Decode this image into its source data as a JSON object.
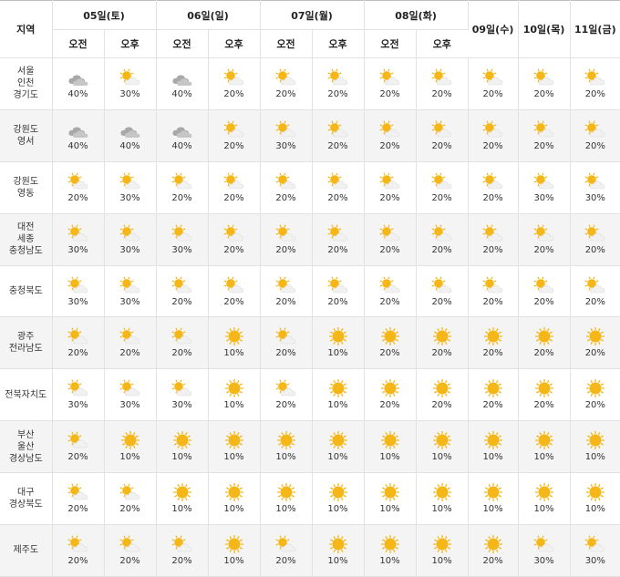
{
  "header": {
    "region_label": "지역",
    "days": [
      {
        "label": "05일(토)",
        "split": true
      },
      {
        "label": "06일(일)",
        "split": true
      },
      {
        "label": "07일(월)",
        "split": true
      },
      {
        "label": "08일(화)",
        "split": true
      },
      {
        "label": "09일(수)",
        "split": false
      },
      {
        "label": "10일(목)",
        "split": false
      },
      {
        "label": "11일(금)",
        "split": false
      }
    ],
    "am_label": "오전",
    "pm_label": "오후"
  },
  "icons": {
    "cloudy": "cloud-icon",
    "partly-cloudy": "sun-behind-cloud-icon",
    "sunny": "sun-icon"
  },
  "colors": {
    "sun": "#f5b617",
    "cloud_light": "#f1f1f1",
    "cloud_dark": "#a8a8a8",
    "row_shade": "#f4f4f4",
    "border": "#e2e2e2"
  },
  "regions": [
    {
      "name": [
        "서울",
        "인천",
        "경기도"
      ],
      "cells": [
        {
          "icon": "cloudy",
          "pct": "40%"
        },
        {
          "icon": "partly-cloudy",
          "pct": "30%"
        },
        {
          "icon": "cloudy",
          "pct": "40%"
        },
        {
          "icon": "partly-cloudy",
          "pct": "20%"
        },
        {
          "icon": "partly-cloudy",
          "pct": "20%"
        },
        {
          "icon": "partly-cloudy",
          "pct": "20%"
        },
        {
          "icon": "partly-cloudy",
          "pct": "20%"
        },
        {
          "icon": "partly-cloudy",
          "pct": "20%"
        },
        {
          "icon": "partly-cloudy",
          "pct": "20%"
        },
        {
          "icon": "partly-cloudy",
          "pct": "20%"
        },
        {
          "icon": "partly-cloudy",
          "pct": "20%"
        }
      ]
    },
    {
      "name": [
        "강원도",
        "영서"
      ],
      "cells": [
        {
          "icon": "cloudy",
          "pct": "40%"
        },
        {
          "icon": "cloudy",
          "pct": "40%"
        },
        {
          "icon": "cloudy",
          "pct": "40%"
        },
        {
          "icon": "partly-cloudy",
          "pct": "20%"
        },
        {
          "icon": "partly-cloudy",
          "pct": "30%"
        },
        {
          "icon": "partly-cloudy",
          "pct": "20%"
        },
        {
          "icon": "partly-cloudy",
          "pct": "20%"
        },
        {
          "icon": "partly-cloudy",
          "pct": "20%"
        },
        {
          "icon": "partly-cloudy",
          "pct": "20%"
        },
        {
          "icon": "partly-cloudy",
          "pct": "20%"
        },
        {
          "icon": "partly-cloudy",
          "pct": "20%"
        }
      ]
    },
    {
      "name": [
        "강원도",
        "영동"
      ],
      "cells": [
        {
          "icon": "partly-cloudy",
          "pct": "20%"
        },
        {
          "icon": "partly-cloudy",
          "pct": "30%"
        },
        {
          "icon": "partly-cloudy",
          "pct": "20%"
        },
        {
          "icon": "partly-cloudy",
          "pct": "20%"
        },
        {
          "icon": "partly-cloudy",
          "pct": "20%"
        },
        {
          "icon": "partly-cloudy",
          "pct": "20%"
        },
        {
          "icon": "partly-cloudy",
          "pct": "20%"
        },
        {
          "icon": "partly-cloudy",
          "pct": "20%"
        },
        {
          "icon": "partly-cloudy",
          "pct": "20%"
        },
        {
          "icon": "partly-cloudy",
          "pct": "30%"
        },
        {
          "icon": "partly-cloudy",
          "pct": "30%"
        }
      ]
    },
    {
      "name": [
        "대전",
        "세종",
        "충청남도"
      ],
      "cells": [
        {
          "icon": "partly-cloudy",
          "pct": "30%"
        },
        {
          "icon": "partly-cloudy",
          "pct": "30%"
        },
        {
          "icon": "partly-cloudy",
          "pct": "30%"
        },
        {
          "icon": "partly-cloudy",
          "pct": "20%"
        },
        {
          "icon": "partly-cloudy",
          "pct": "20%"
        },
        {
          "icon": "partly-cloudy",
          "pct": "20%"
        },
        {
          "icon": "partly-cloudy",
          "pct": "20%"
        },
        {
          "icon": "partly-cloudy",
          "pct": "20%"
        },
        {
          "icon": "partly-cloudy",
          "pct": "20%"
        },
        {
          "icon": "partly-cloudy",
          "pct": "20%"
        },
        {
          "icon": "partly-cloudy",
          "pct": "20%"
        }
      ]
    },
    {
      "name": [
        "충청북도"
      ],
      "cells": [
        {
          "icon": "partly-cloudy",
          "pct": "30%"
        },
        {
          "icon": "partly-cloudy",
          "pct": "30%"
        },
        {
          "icon": "partly-cloudy",
          "pct": "20%"
        },
        {
          "icon": "partly-cloudy",
          "pct": "20%"
        },
        {
          "icon": "partly-cloudy",
          "pct": "20%"
        },
        {
          "icon": "partly-cloudy",
          "pct": "20%"
        },
        {
          "icon": "partly-cloudy",
          "pct": "20%"
        },
        {
          "icon": "partly-cloudy",
          "pct": "20%"
        },
        {
          "icon": "partly-cloudy",
          "pct": "20%"
        },
        {
          "icon": "partly-cloudy",
          "pct": "20%"
        },
        {
          "icon": "partly-cloudy",
          "pct": "20%"
        }
      ]
    },
    {
      "name": [
        "광주",
        "전라남도"
      ],
      "cells": [
        {
          "icon": "partly-cloudy",
          "pct": "20%"
        },
        {
          "icon": "partly-cloudy",
          "pct": "20%"
        },
        {
          "icon": "partly-cloudy",
          "pct": "20%"
        },
        {
          "icon": "sunny",
          "pct": "10%"
        },
        {
          "icon": "partly-cloudy",
          "pct": "20%"
        },
        {
          "icon": "sunny",
          "pct": "10%"
        },
        {
          "icon": "sunny",
          "pct": "20%"
        },
        {
          "icon": "sunny",
          "pct": "20%"
        },
        {
          "icon": "sunny",
          "pct": "20%"
        },
        {
          "icon": "sunny",
          "pct": "20%"
        },
        {
          "icon": "sunny",
          "pct": "20%"
        }
      ]
    },
    {
      "name": [
        "전북자치도"
      ],
      "cells": [
        {
          "icon": "partly-cloudy",
          "pct": "30%"
        },
        {
          "icon": "partly-cloudy",
          "pct": "30%"
        },
        {
          "icon": "partly-cloudy",
          "pct": "30%"
        },
        {
          "icon": "sunny",
          "pct": "10%"
        },
        {
          "icon": "partly-cloudy",
          "pct": "20%"
        },
        {
          "icon": "sunny",
          "pct": "10%"
        },
        {
          "icon": "sunny",
          "pct": "20%"
        },
        {
          "icon": "sunny",
          "pct": "20%"
        },
        {
          "icon": "sunny",
          "pct": "20%"
        },
        {
          "icon": "sunny",
          "pct": "20%"
        },
        {
          "icon": "sunny",
          "pct": "20%"
        }
      ]
    },
    {
      "name": [
        "부산",
        "울산",
        "경상남도"
      ],
      "cells": [
        {
          "icon": "partly-cloudy",
          "pct": "20%"
        },
        {
          "icon": "sunny",
          "pct": "10%"
        },
        {
          "icon": "sunny",
          "pct": "10%"
        },
        {
          "icon": "sunny",
          "pct": "10%"
        },
        {
          "icon": "sunny",
          "pct": "10%"
        },
        {
          "icon": "sunny",
          "pct": "10%"
        },
        {
          "icon": "sunny",
          "pct": "10%"
        },
        {
          "icon": "sunny",
          "pct": "10%"
        },
        {
          "icon": "sunny",
          "pct": "10%"
        },
        {
          "icon": "sunny",
          "pct": "10%"
        },
        {
          "icon": "sunny",
          "pct": "10%"
        }
      ]
    },
    {
      "name": [
        "대구",
        "경상북도"
      ],
      "cells": [
        {
          "icon": "partly-cloudy",
          "pct": "20%"
        },
        {
          "icon": "partly-cloudy",
          "pct": "20%"
        },
        {
          "icon": "sunny",
          "pct": "10%"
        },
        {
          "icon": "sunny",
          "pct": "10%"
        },
        {
          "icon": "sunny",
          "pct": "10%"
        },
        {
          "icon": "sunny",
          "pct": "10%"
        },
        {
          "icon": "sunny",
          "pct": "10%"
        },
        {
          "icon": "sunny",
          "pct": "10%"
        },
        {
          "icon": "sunny",
          "pct": "10%"
        },
        {
          "icon": "sunny",
          "pct": "10%"
        },
        {
          "icon": "sunny",
          "pct": "10%"
        }
      ]
    },
    {
      "name": [
        "제주도"
      ],
      "cells": [
        {
          "icon": "partly-cloudy",
          "pct": "20%"
        },
        {
          "icon": "partly-cloudy",
          "pct": "20%"
        },
        {
          "icon": "partly-cloudy",
          "pct": "20%"
        },
        {
          "icon": "sunny",
          "pct": "10%"
        },
        {
          "icon": "partly-cloudy",
          "pct": "20%"
        },
        {
          "icon": "sunny",
          "pct": "10%"
        },
        {
          "icon": "sunny",
          "pct": "10%"
        },
        {
          "icon": "sunny",
          "pct": "10%"
        },
        {
          "icon": "sunny",
          "pct": "20%"
        },
        {
          "icon": "partly-cloudy",
          "pct": "30%"
        },
        {
          "icon": "partly-cloudy",
          "pct": "30%"
        }
      ]
    }
  ]
}
